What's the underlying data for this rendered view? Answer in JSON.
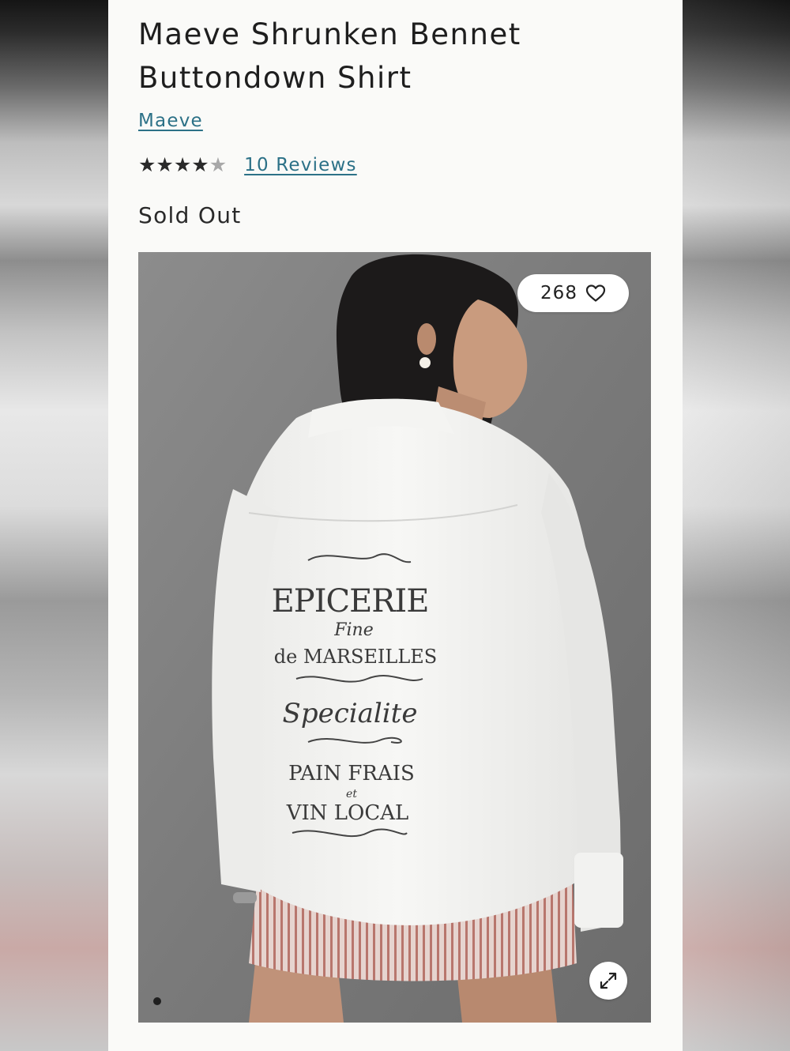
{
  "product": {
    "title": "Maeve Shrunken Bennet Buttondown Shirt",
    "brand": "Maeve",
    "rating": {
      "value": 4,
      "max": 5,
      "reviews_label": "10 Reviews"
    },
    "availability": "Sold Out"
  },
  "gallery": {
    "wishlist_count": "268",
    "wishlist_icon": "heart-outline-icon",
    "expand_icon": "expand-arrows-icon",
    "image_count": 1,
    "current_index": 0,
    "shirt_print_lines": [
      "EPICERIE",
      "Fine",
      "de MARSEILLES",
      "Specialite",
      "PAIN FRAIS",
      "et",
      "VIN LOCAL"
    ]
  },
  "colors": {
    "link": "#2c7187",
    "text": "#1e1e1e",
    "star_filled": "#2a2a2a",
    "star_empty": "#a8a8a8"
  }
}
